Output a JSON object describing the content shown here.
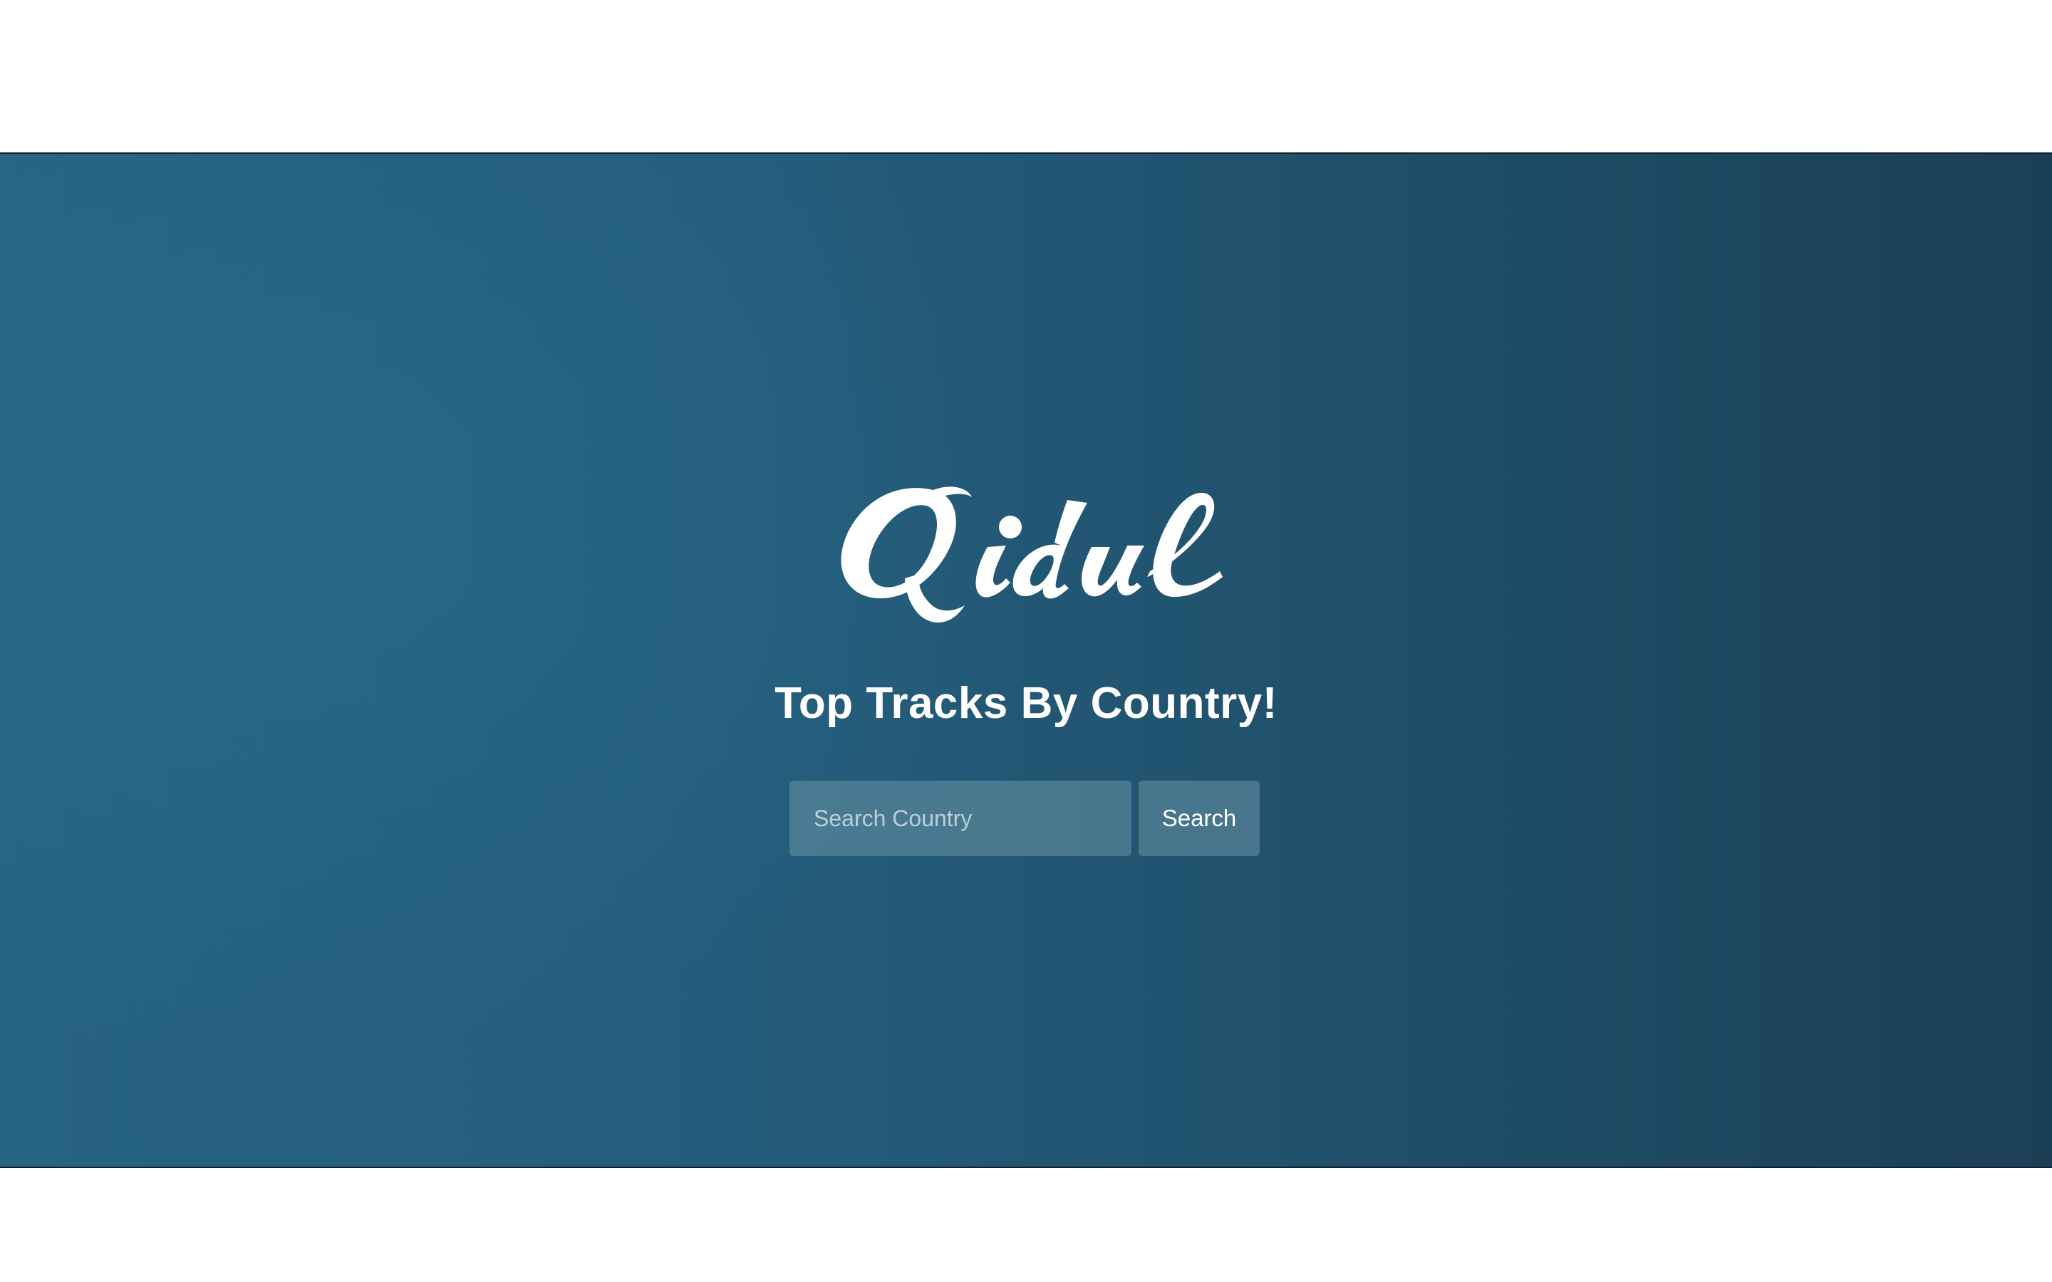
{
  "brand": {
    "logo_text": "Qidul"
  },
  "hero": {
    "tagline": "Top Tracks By Country!"
  },
  "search": {
    "placeholder": "Search Country",
    "value": "",
    "button_label": "Search"
  },
  "colors": {
    "hero_start": "#276482",
    "hero_end": "#1b3f56",
    "text": "#ffffff",
    "control_bg": "#4e7a8c"
  }
}
